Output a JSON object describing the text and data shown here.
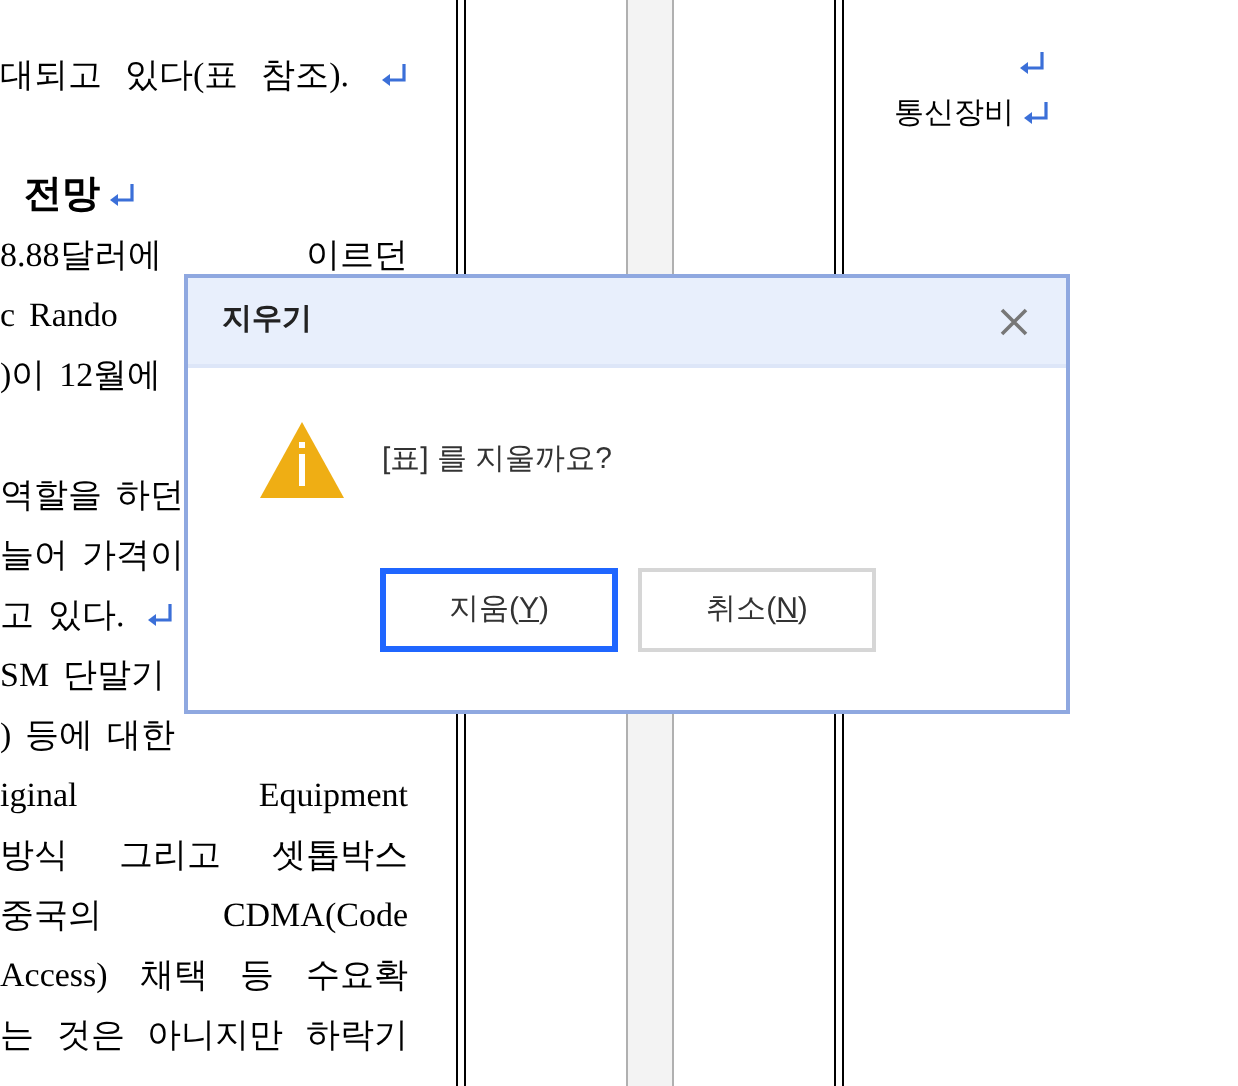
{
  "document": {
    "lines": [
      {
        "kind": "text",
        "words": [
          "대되고",
          "있다(표",
          "참조)."
        ],
        "paragraph_end": true
      },
      {
        "kind": "blank"
      },
      {
        "kind": "heading",
        "words": [
          "전망"
        ],
        "paragraph_end": true
      },
      {
        "kind": "text",
        "words": [
          "8.88달러에",
          "이르던"
        ],
        "paragraph_end": false
      },
      {
        "kind": "partial",
        "words": [
          "c",
          "Rando"
        ],
        "paragraph_end": false
      },
      {
        "kind": "partial",
        "words": [
          ")이",
          "12월에"
        ],
        "paragraph_end": false
      },
      {
        "kind": "blank"
      },
      {
        "kind": "partial",
        "words": [
          "역할을",
          "하던"
        ],
        "paragraph_end": false
      },
      {
        "kind": "partial",
        "words": [
          "늘어",
          "가격이"
        ],
        "paragraph_end": false
      },
      {
        "kind": "partial",
        "words": [
          "고",
          "있다."
        ],
        "paragraph_end": true
      },
      {
        "kind": "partial",
        "words": [
          "SM",
          "단말기"
        ],
        "paragraph_end": false
      },
      {
        "kind": "partial",
        "words": [
          ")",
          "등에",
          "대한"
        ],
        "paragraph_end": false
      },
      {
        "kind": "text",
        "words": [
          "iginal",
          "Equipment"
        ],
        "paragraph_end": false
      },
      {
        "kind": "text",
        "words": [
          "방식",
          "그리고",
          "셋톱박스"
        ],
        "paragraph_end": false
      },
      {
        "kind": "text",
        "words": [
          "중국의",
          "CDMA(Code"
        ],
        "paragraph_end": false
      },
      {
        "kind": "text",
        "words": [
          "Access)",
          "채택",
          "등",
          "수요확"
        ],
        "paragraph_end": false
      },
      {
        "kind": "text",
        "words": [
          "는",
          "것은",
          "아니지만",
          "하락기"
        ],
        "paragraph_end": false
      }
    ]
  },
  "table_cell": {
    "text": "통신장비"
  },
  "dialog": {
    "title": "지우기",
    "message": "[표] 를 지울까요?",
    "buttons": [
      {
        "text_before": "지움(",
        "mnemonic": "Y",
        "text_after": ")",
        "selected": true
      },
      {
        "text_before": "취소(",
        "mnemonic": "N",
        "text_after": ")",
        "selected": false
      }
    ]
  }
}
